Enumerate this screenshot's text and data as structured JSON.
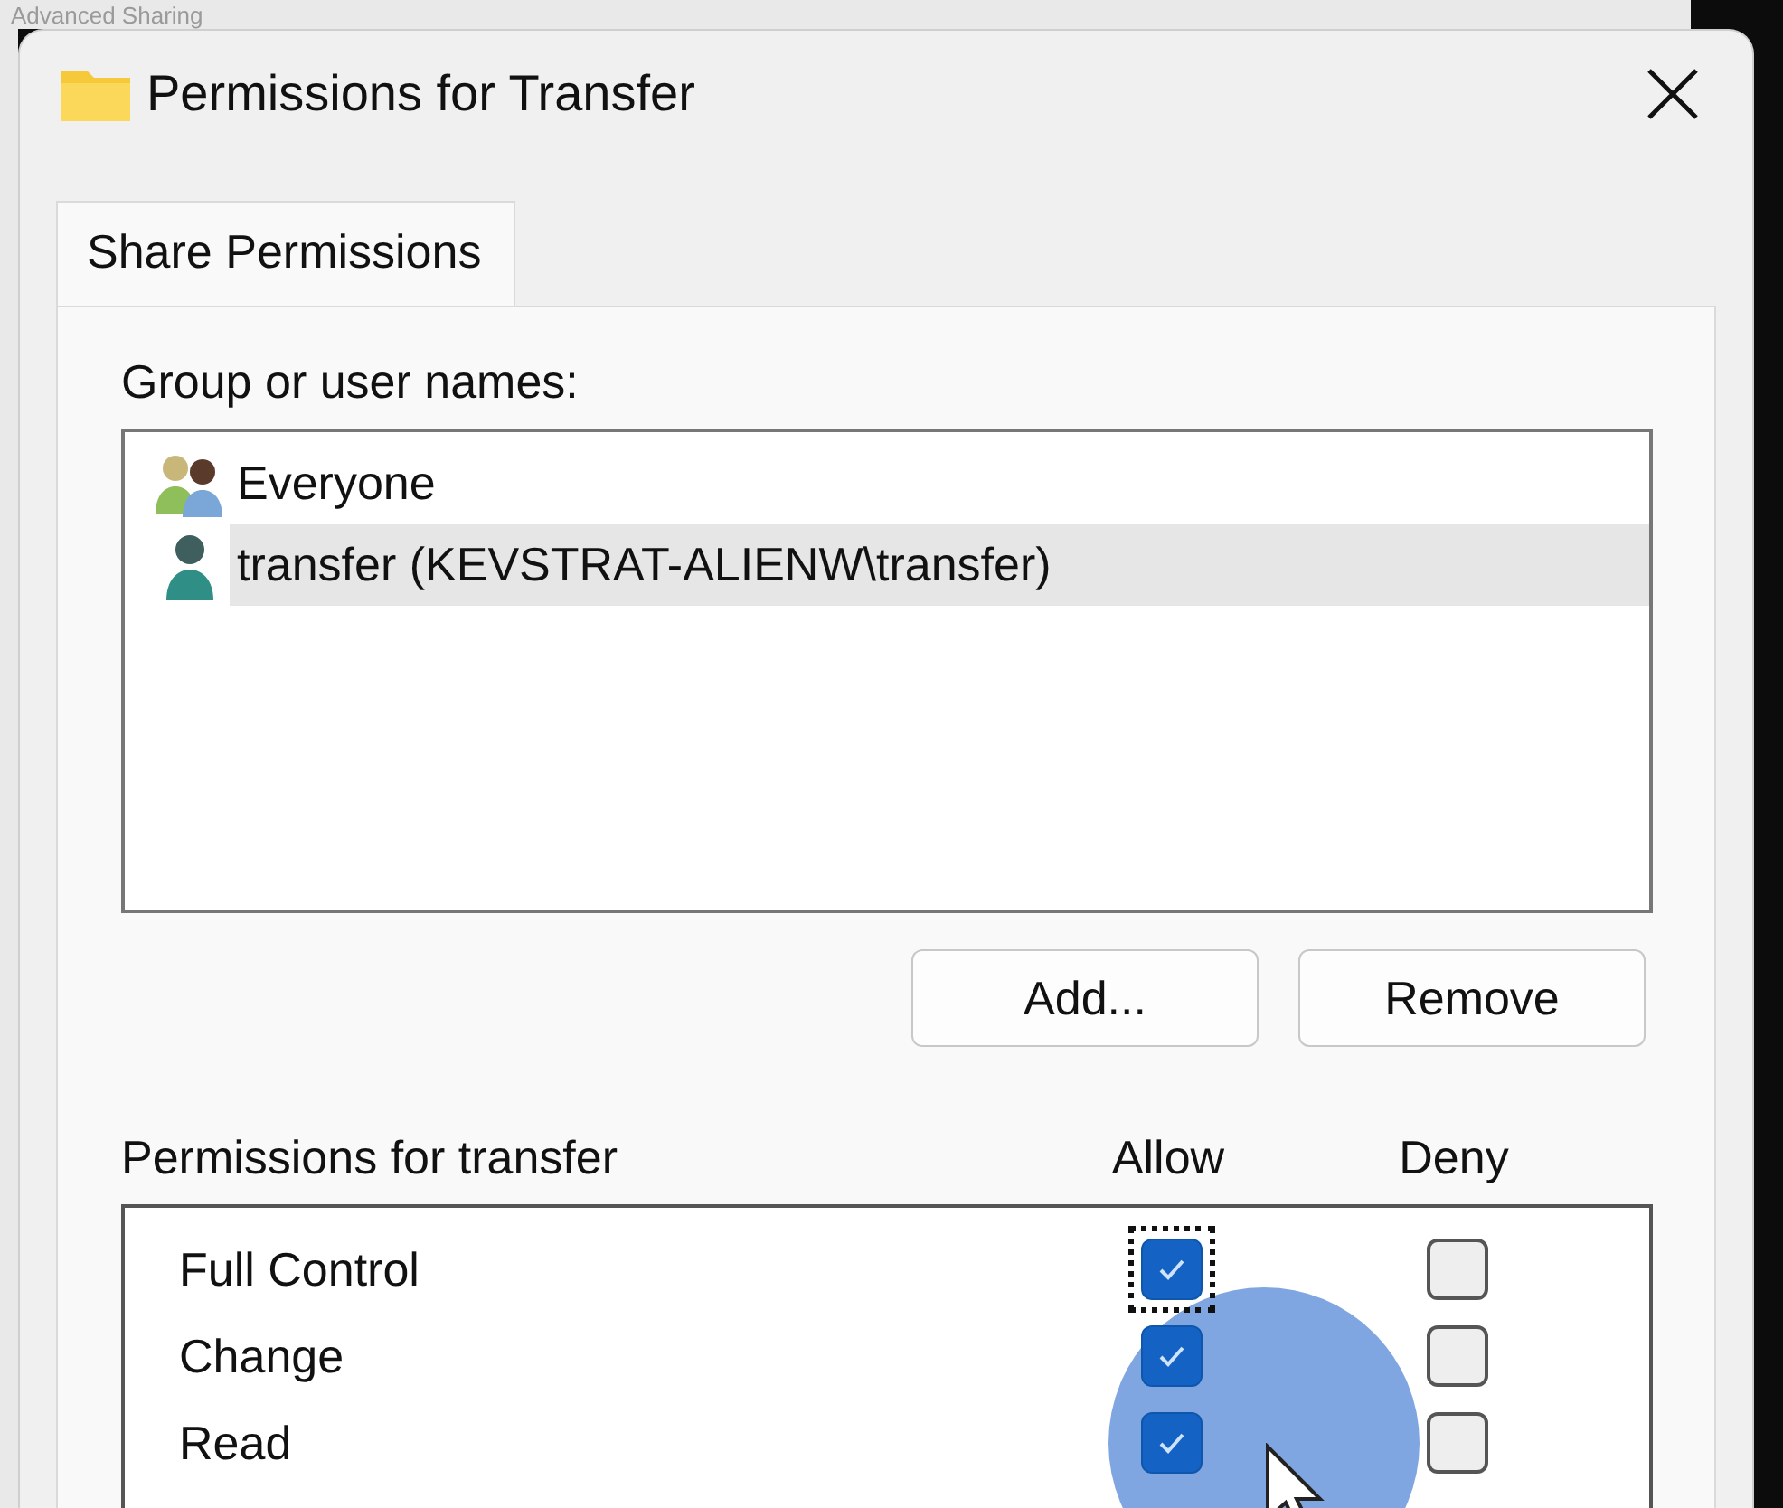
{
  "background_window": {
    "title": "Advanced Sharing"
  },
  "window": {
    "title": "Permissions for Transfer"
  },
  "tabs": [
    {
      "label": "Share Permissions",
      "selected": true
    }
  ],
  "group_label": "Group or user names:",
  "users": [
    {
      "name": "Everyone",
      "kind": "group",
      "selected": false
    },
    {
      "name": "transfer (KEVSTRAT-ALIENW\\transfer)",
      "kind": "user",
      "selected": true
    }
  ],
  "buttons": [
    "Add...",
    "Remove"
  ],
  "permissions": {
    "label": "Permissions for transfer",
    "columns": [
      "Allow",
      "Deny"
    ],
    "rows": [
      {
        "name": "Full Control",
        "allow": true,
        "deny": false,
        "focused": true
      },
      {
        "name": "Change",
        "allow": true,
        "deny": false,
        "focused": false
      },
      {
        "name": "Read",
        "allow": true,
        "deny": false,
        "focused": false
      }
    ]
  }
}
